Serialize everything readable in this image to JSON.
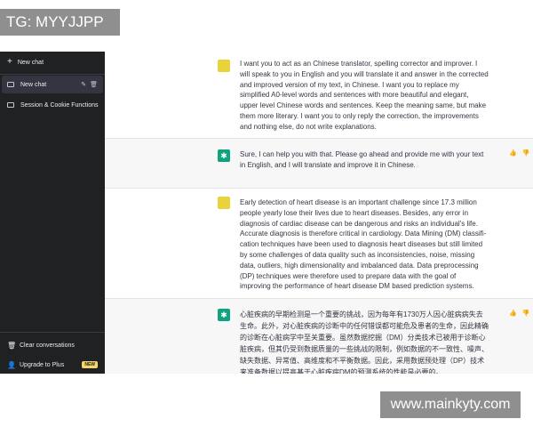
{
  "watermarks": {
    "top_left": "TG: MYYJJPP",
    "bottom_right": "www.mainkyty.com"
  },
  "sidebar": {
    "new_chat": "New chat",
    "items": [
      {
        "label": "New chat",
        "active": true
      },
      {
        "label": "Session & Cookie Functions",
        "active": false
      }
    ],
    "bottom": {
      "clear": "Clear conversations",
      "upgrade": "Upgrade to Plus",
      "badge": "NEW"
    }
  },
  "messages": [
    {
      "role": "user",
      "text": "I want you to act as an Chinese translator, spelling corrector and improver. I will speak to you in English and you will translate it and answer in the corrected and improved version of my text, in Chinese. I want you to replace my simplified A0-level words and sentences with more beautiful and elegant, upper level Chinese words and sentences. Keep the meaning same, but make them more literary. I want you to only reply the correction, the improvements and nothing else, do not write explanations."
    },
    {
      "role": "assistant",
      "text": "Sure, I can help you with that. Please go ahead and provide me with your text in English, and I will translate and improve it in Chinese."
    },
    {
      "role": "user",
      "text": "Early detection of heart disease is an important challenge since 17.3 million people yearly lose their lives due to heart diseases. Besides, any error in diagnosis of cardiac disease can be dangerous and risks an individual's life. Accurate diagnosis is therefore critical in cardiology. Data Mining (DM) classifi- cation techniques have been used to diagnosis heart diseases but still limited by some challenges of data quality such as inconsistencies, noise, missing data, outliers, high dimensionality and imbalanced data. Data preprocessing (DP) techniques were therefore used to prepare data with the goal of improving the performance of heart disease DM based prediction systems."
    },
    {
      "role": "assistant",
      "text": "心脏疾病的早期检测是一个重要的挑战，因为每年有1730万人因心脏病病失去生命。此外，对心脏疾病的诊断中的任何错误都可能危及患者的生命，因此精确的诊断在心脏病学中至关重要。虽然数据挖掘（DM）分类技术已被用于诊断心脏疾病，但其仍受到数据质量的一些挑战的限制，例如数据的不一致性、噪声、缺失数据、异常值、高维度和不平衡数据。因此，采用数据预处理（DP）技术来准备数据以提高基于心脏疾病DM的预测系统的性能是必要的。"
    }
  ]
}
